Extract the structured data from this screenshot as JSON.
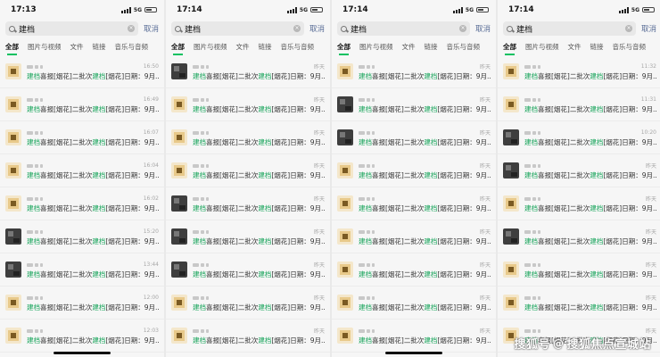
{
  "panels": [
    {
      "status_time": "17:13",
      "network": "5G",
      "search_query": "建档",
      "cancel": "取消",
      "tabs": [
        "全部",
        "图片与视频",
        "文件",
        "链接",
        "音乐与音频"
      ],
      "items": [
        {
          "time": "16:50",
          "avatar": "light",
          "kw": "建档",
          "mid": "喜报[烟花]二批次",
          "kw2": "建档",
          "tail": "[烟花]日期：9月..."
        },
        {
          "time": "16:49",
          "avatar": "light",
          "kw": "建档",
          "mid": "喜报[烟花]二批次",
          "kw2": "建档",
          "tail": "[烟花]日期：9月..."
        },
        {
          "time": "16:07",
          "avatar": "light",
          "kw": "建档",
          "mid": "喜报[烟花]二批次",
          "kw2": "建档",
          "tail": "[烟花]日期：9月..."
        },
        {
          "time": "16:04",
          "avatar": "light",
          "kw": "建档",
          "mid": "喜报[烟花]二批次",
          "kw2": "建档",
          "tail": "[烟花]日期：9月..."
        },
        {
          "time": "16:02",
          "avatar": "light",
          "kw": "建档",
          "mid": "喜报[烟花]二批次",
          "kw2": "建档",
          "tail": "[烟花]日期：9月..."
        },
        {
          "time": "15:20",
          "avatar": "dark",
          "kw": "建档",
          "mid": "喜报[烟花]二批次",
          "kw2": "建档",
          "tail": "[烟花]日期：9月..."
        },
        {
          "time": "13:44",
          "avatar": "dark",
          "kw": "建档",
          "mid": "喜报[烟花]二批次",
          "kw2": "建档",
          "tail": "[烟花]日期：9月..."
        },
        {
          "time": "12:00",
          "avatar": "light",
          "kw": "建档",
          "mid": "喜报[烟花]二批次",
          "kw2": "建档",
          "tail": "[烟花]日期：9月..."
        },
        {
          "time": "12:03",
          "avatar": "light",
          "kw": "建档",
          "mid": "喜报[烟花]二批次",
          "kw2": "建档",
          "tail": "[烟花]日期：9月..."
        }
      ]
    },
    {
      "status_time": "17:14",
      "network": "5G",
      "search_query": "建档",
      "cancel": "取消",
      "tabs": [
        "全部",
        "图片与视频",
        "文件",
        "链接",
        "音乐与音频"
      ],
      "items": [
        {
          "time": "昨天",
          "avatar": "dark",
          "kw": "建档",
          "mid": "喜报[烟花]二批次",
          "kw2": "建档",
          "tail": "[烟花]日期：9月..."
        },
        {
          "time": "昨天",
          "avatar": "light",
          "kw": "建档",
          "mid": "喜报[烟花]二批次",
          "kw2": "建档",
          "tail": "[烟花]日期：9月..."
        },
        {
          "time": "昨天",
          "avatar": "light",
          "kw": "建档",
          "mid": "喜报[烟花]二批次",
          "kw2": "建档",
          "tail": "[烟花]日期：9月..."
        },
        {
          "time": "昨天",
          "avatar": "light",
          "kw": "建档",
          "mid": "喜报[烟花]二批次",
          "kw2": "建档",
          "tail": "[烟花]日期：9月..."
        },
        {
          "time": "昨天",
          "avatar": "dark",
          "kw": "建档",
          "mid": "喜报[烟花]二批次",
          "kw2": "建档",
          "tail": "[烟花]日期：9月..."
        },
        {
          "time": "昨天",
          "avatar": "dark",
          "kw": "建档",
          "mid": "喜报[烟花]二批次",
          "kw2": "建档",
          "tail": "[烟花]日期：9月..."
        },
        {
          "time": "昨天",
          "avatar": "dark",
          "kw": "建档",
          "mid": "喜报[烟花]二批次",
          "kw2": "建档",
          "tail": "[烟花]日期：9月..."
        },
        {
          "time": "昨天",
          "avatar": "light",
          "kw": "建档",
          "mid": "喜报[烟花]二批次",
          "kw2": "建档",
          "tail": "[烟花]日期：9月..."
        },
        {
          "time": "昨天",
          "avatar": "light",
          "kw": "建档",
          "mid": "喜报[烟花]二批次",
          "kw2": "建档",
          "tail": "[烟花]日期：9月..."
        }
      ]
    },
    {
      "status_time": "17:14",
      "network": "5G",
      "search_query": "建档",
      "cancel": "取消",
      "tabs": [
        "全部",
        "图片与视频",
        "文件",
        "链接",
        "音乐与音频"
      ],
      "items": [
        {
          "time": "昨天",
          "avatar": "light",
          "kw": "建档",
          "mid": "喜报[烟花]二批次",
          "kw2": "建档",
          "tail": "[烟花]日期：9月..."
        },
        {
          "time": "昨天",
          "avatar": "dark",
          "kw": "建档",
          "mid": "喜报[烟花]二批次",
          "kw2": "建档",
          "tail": "[烟花]日期：9月..."
        },
        {
          "time": "昨天",
          "avatar": "dark",
          "kw": "建档",
          "mid": "喜报[烟花]二批次",
          "kw2": "建档",
          "tail": "[烟花]日期：9月..."
        },
        {
          "time": "昨天",
          "avatar": "light",
          "kw": "建档",
          "mid": "喜报[烟花]二批次",
          "kw2": "建档",
          "tail": "[烟花]日期：9月..."
        },
        {
          "time": "昨天",
          "avatar": "light",
          "kw": "建档",
          "mid": "喜报[烟花]二批次",
          "kw2": "建档",
          "tail": "[烟花]日期：9月..."
        },
        {
          "time": "昨天",
          "avatar": "light",
          "kw": "建档",
          "mid": "喜报[烟花]二批次",
          "kw2": "建档",
          "tail": "[烟花]日期：9月..."
        },
        {
          "time": "昨天",
          "avatar": "light",
          "kw": "建档",
          "mid": "喜报[烟花]二批次",
          "kw2": "建档",
          "tail": "[烟花]日期：9月..."
        },
        {
          "time": "昨天",
          "avatar": "light",
          "kw": "建档",
          "mid": "喜报[烟花]二批次",
          "kw2": "建档",
          "tail": "[烟花]日期：9月..."
        },
        {
          "time": "昨天",
          "avatar": "light",
          "kw": "建档",
          "mid": "喜报[烟花]二批次",
          "kw2": "建档",
          "tail": "[烟花]日期：9月..."
        }
      ]
    },
    {
      "status_time": "17:14",
      "network": "5G",
      "search_query": "建档",
      "cancel": "取消",
      "tabs": [
        "全部",
        "图片与视频",
        "文件",
        "链接",
        "音乐与音频"
      ],
      "items": [
        {
          "time": "11:32",
          "avatar": "light",
          "kw": "建档",
          "mid": "喜报[烟花]二批次",
          "kw2": "建档",
          "tail": "[烟花]日期：9月..."
        },
        {
          "time": "11:31",
          "avatar": "light",
          "kw": "建档",
          "mid": "喜报[烟花]二批次",
          "kw2": "建档",
          "tail": "[烟花]日期：9月..."
        },
        {
          "time": "10:20",
          "avatar": "dark",
          "kw": "建档",
          "mid": "喜报[烟花]二批次",
          "kw2": "建档",
          "tail": "[烟花]日期：9月..."
        },
        {
          "time": "昨天",
          "avatar": "dark",
          "kw": "建档",
          "mid": "喜报[烟花]二批次",
          "kw2": "建档",
          "tail": "[烟花]日期：9月..."
        },
        {
          "time": "昨天",
          "avatar": "light",
          "kw": "建档",
          "mid": "喜报[烟花]二批次",
          "kw2": "建档",
          "tail": "[烟花]日期：9月..."
        },
        {
          "time": "昨天",
          "avatar": "dark",
          "kw": "建档",
          "mid": "喜报[烟花]二批次",
          "kw2": "建档",
          "tail": "[烟花]日期：9月..."
        },
        {
          "time": "昨天",
          "avatar": "light",
          "kw": "建档",
          "mid": "喜报[烟花]二批次",
          "kw2": "建档",
          "tail": "[烟花]日期：9月..."
        },
        {
          "time": "昨天",
          "avatar": "light",
          "kw": "建档",
          "mid": "喜报[烟花]二批次",
          "kw2": "建档",
          "tail": "[烟花]日期：9月..."
        },
        {
          "time": "昨天",
          "avatar": "light",
          "kw": "建档",
          "mid": "喜报[烟花]二批次",
          "kw2": "建档",
          "tail": "[烟花]日期：9月..."
        }
      ]
    }
  ],
  "watermark": {
    "brand": "搜狐号",
    "at": "@",
    "account": "搜狐焦点宣城站"
  },
  "colors": {
    "keyword": "#17a45a",
    "cancel": "#576b95",
    "tab_underline": "#07c160"
  }
}
